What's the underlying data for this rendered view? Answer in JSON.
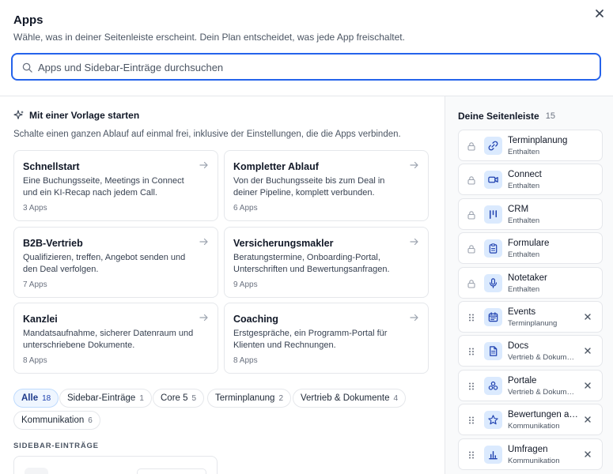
{
  "header": {
    "title": "Apps",
    "subtitle": "Wähle, was in deiner Seitenleiste erscheint. Dein Plan entscheidet, was jede App freischaltet.",
    "search_placeholder": "Apps und Sidebar-Einträge durchsuchen"
  },
  "templates": {
    "heading": "Mit einer Vorlage starten",
    "description": "Schalte einen ganzen Ablauf auf einmal frei, inklusive der Einstellungen, die die Apps verbinden.",
    "cards": [
      {
        "title": "Schnellstart",
        "description": "Eine Buchungsseite, Meetings in Connect und ein KI-Recap nach jedem Call.",
        "count": "3 Apps"
      },
      {
        "title": "Kompletter Ablauf",
        "description": "Von der Buchungsseite bis zum Deal in deiner Pipeline, komplett verbunden.",
        "count": "6 Apps"
      },
      {
        "title": "B2B-Vertrieb",
        "description": "Qualifizieren, treffen, Angebot senden und den Deal verfolgen.",
        "count": "7 Apps"
      },
      {
        "title": "Versicherungsmakler",
        "description": "Beratungstermine, Onboarding-Portal, Unterschriften und Bewertungsanfragen.",
        "count": "9 Apps"
      },
      {
        "title": "Kanzlei",
        "description": "Mandatsaufnahme, sicherer Datenraum und unterschriebene Dokumente.",
        "count": "8 Apps"
      },
      {
        "title": "Coaching",
        "description": "Erstgespräche, ein Programm-Portal für Klienten und Rechnungen.",
        "count": "8 Apps"
      }
    ]
  },
  "filters": [
    {
      "label": "Alle",
      "count": "18",
      "active": true
    },
    {
      "label": "Sidebar-Einträge",
      "count": "1"
    },
    {
      "label": "Core 5",
      "count": "5"
    },
    {
      "label": "Terminplanung",
      "count": "2"
    },
    {
      "label": "Vertrieb & Dokumente",
      "count": "4"
    },
    {
      "label": "Kommunikation",
      "count": "6"
    }
  ],
  "section_label": "SIDEBAR-EINTRÄGE",
  "sidebar": {
    "title": "Deine Seitenleiste",
    "count": "15",
    "items": [
      {
        "name": "Terminplanung",
        "sub": "Enthalten",
        "icon": "link-icon",
        "locked": true
      },
      {
        "name": "Connect",
        "sub": "Enthalten",
        "icon": "video-icon",
        "locked": true
      },
      {
        "name": "CRM",
        "sub": "Enthalten",
        "icon": "pipeline-icon",
        "locked": true
      },
      {
        "name": "Formulare",
        "sub": "Enthalten",
        "icon": "clipboard-icon",
        "locked": true
      },
      {
        "name": "Notetaker",
        "sub": "Enthalten",
        "icon": "microphone-icon",
        "locked": true
      },
      {
        "name": "Events",
        "sub": "Terminplanung",
        "icon": "calendar-icon",
        "locked": false
      },
      {
        "name": "Docs",
        "sub": "Vertrieb & Dokumente",
        "icon": "document-icon",
        "locked": false
      },
      {
        "name": "Portale",
        "sub": "Vertrieb & Dokumente",
        "icon": "portal-icon",
        "locked": false
      },
      {
        "name": "Bewertungen anfragen",
        "sub": "Kommunikation",
        "icon": "star-icon",
        "locked": false
      },
      {
        "name": "Umfragen",
        "sub": "Kommunikation",
        "icon": "bar-chart-icon",
        "locked": false
      }
    ]
  },
  "colors": {
    "accent": "#2563eb",
    "icon_bg": "#dbeafe",
    "border": "#e5e7eb"
  }
}
